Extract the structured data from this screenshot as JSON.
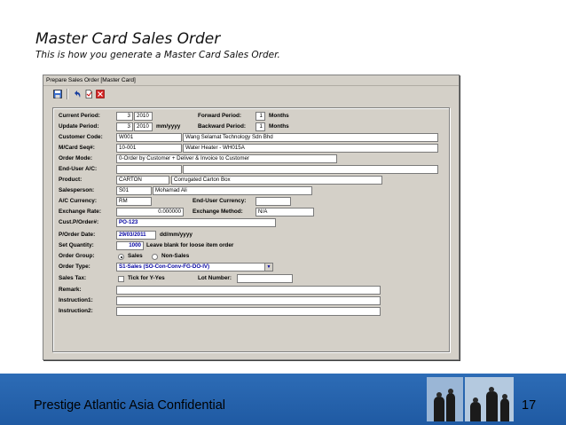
{
  "slide": {
    "title": "Master Card Sales Order",
    "subtitle": "This is how you generate a Master Card Sales Order."
  },
  "window": {
    "title": "Prepare Sales Order [Master Card]",
    "toolbar": [
      "save-icon",
      "undo-icon",
      "new-icon",
      "close-icon"
    ]
  },
  "form": {
    "current_period": {
      "label": "Current Period:",
      "month": "3",
      "year": "2010"
    },
    "forward_period": {
      "label": "Forward Period:",
      "value": "1",
      "unit": "Months"
    },
    "update_period": {
      "label": "Update Period:",
      "month": "3",
      "year": "2010",
      "format": "mm/yyyy"
    },
    "backward_period": {
      "label": "Backward Period:",
      "value": "1",
      "unit": "Months"
    },
    "customer_code": {
      "label": "Customer Code:",
      "code": "W001",
      "name": "Wang Selamat Technology Sdn Bhd"
    },
    "mcard_seq": {
      "label": "M/Card Seq#:",
      "code": "10-001",
      "name": "Water Heater - WH015A"
    },
    "order_mode": {
      "label": "Order Mode:",
      "value": "0-Order by Customer + Deliver & Invoice to Customer"
    },
    "end_user": {
      "label": "End-User A/C:",
      "code": "",
      "name": ""
    },
    "product": {
      "label": "Product:",
      "code": "CARTON",
      "name": "Corrugated Carton Box"
    },
    "salesperson": {
      "label": "Salesperson:",
      "code": "S01",
      "name": "Mohamad Ali"
    },
    "ac_currency": {
      "label": "A/C Currency:",
      "value": "RM"
    },
    "enduser_currency": {
      "label": "End-User Currency:",
      "value": ""
    },
    "exchange_rate": {
      "label": "Exchange Rate:",
      "value": "0.000000"
    },
    "exchange_method": {
      "label": "Exchange Method:",
      "value": "N/A"
    },
    "cust_po": {
      "label": "Cust.P/Order#:",
      "value": "PO-123"
    },
    "po_date": {
      "label": "P/Order Date:",
      "value": "29/03/2011",
      "format": "dd/mm/yyyy"
    },
    "set_quantity": {
      "label": "Set Quantity:",
      "value": "1000",
      "hint": "Leave blank for loose item order"
    },
    "order_group": {
      "label": "Order Group:",
      "opt1": "Sales",
      "opt2": "Non-Sales",
      "selected": "Sales"
    },
    "order_type": {
      "label": "Order Type:",
      "value": "S1-Sales (SO-Con-Conv-FG-DO-IV)"
    },
    "sales_tax": {
      "label": "Sales Tax:",
      "check_label": "Tick for Y-Yes",
      "checked": false
    },
    "lot_number": {
      "label": "Lot Number:",
      "value": ""
    },
    "remark": {
      "label": "Remark:",
      "value": ""
    },
    "instruction1": {
      "label": "Instruction1:",
      "value": ""
    },
    "instruction2": {
      "label": "Instruction2:",
      "value": ""
    }
  },
  "footer": {
    "text": "Prestige Atlantic Asia Confidential",
    "page": "17",
    "color": "#2560ab"
  }
}
